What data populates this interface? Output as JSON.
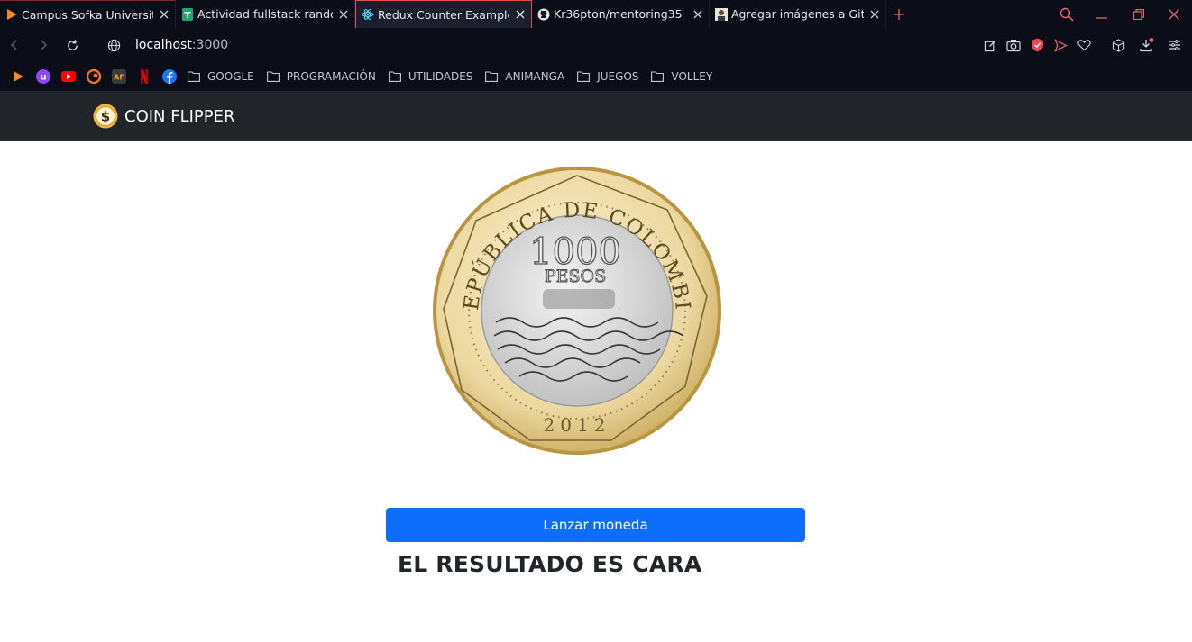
{
  "browser": {
    "tabs": [
      {
        "title": "Campus Sofka University",
        "icon": "play-logo-icon",
        "active": false
      },
      {
        "title": "Actividad fullstack random...",
        "icon": "sheets-icon",
        "active": false
      },
      {
        "title": "Redux Counter Example",
        "icon": "react-icon",
        "active": true
      },
      {
        "title": "Kr36pton/mentoring35",
        "icon": "github-icon",
        "active": false
      },
      {
        "title": "Agregar imágenes a GitHub",
        "icon": "avatar-icon",
        "active": false
      }
    ],
    "address": {
      "host": "localhost",
      "port": ":3000"
    },
    "bookmarks": {
      "folders": [
        "GOOGLE",
        "PROGRAMACIÓN",
        "UTILIDADES",
        "ANIMANGA",
        "JUEGOS",
        "VOLLEY"
      ]
    },
    "colors": {
      "accent": "#d9534f",
      "chrome": "#0b0d18"
    }
  },
  "app": {
    "brand": "COIN FLIPPER",
    "coin": {
      "ring_text": "REPÚBLICA DE COLOMBIA",
      "value": "1000",
      "currency": "PESOS",
      "year": "2012"
    },
    "button_label": "Lanzar moneda",
    "result_text": "EL RESULTADO ES CARA",
    "colors": {
      "navbar": "#212529",
      "button": "#0d6efd"
    }
  }
}
